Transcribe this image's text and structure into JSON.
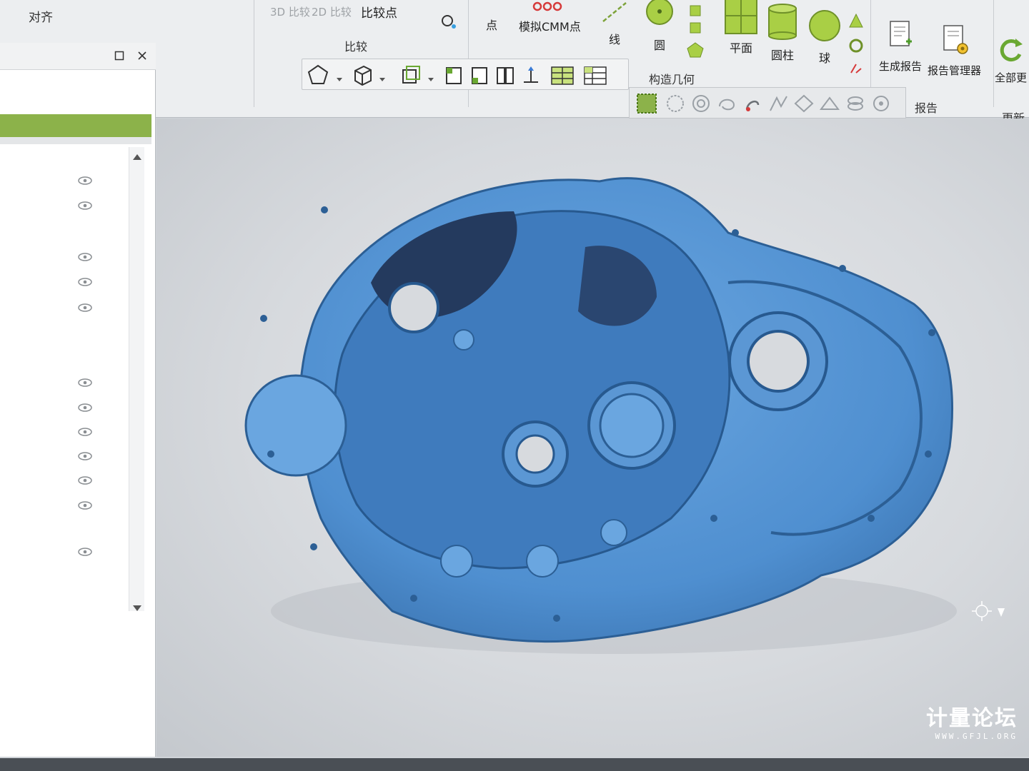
{
  "ribbon": {
    "align_group": {
      "label": "对齐"
    },
    "compare_group": {
      "label": "比较",
      "buttons": [
        {
          "label": "3D 比较"
        },
        {
          "label": "2D 比较"
        },
        {
          "label": "比较点"
        }
      ]
    },
    "construct_group": {
      "label": "构造几何",
      "buttons": [
        {
          "label": "点"
        },
        {
          "label": "模拟CMM点"
        },
        {
          "label": "线"
        },
        {
          "label": "圆"
        },
        {
          "label": "平面"
        },
        {
          "label": "圆柱"
        },
        {
          "label": "球"
        }
      ]
    },
    "report_group": {
      "label": "报告",
      "buttons": [
        {
          "label": "生成报告"
        },
        {
          "label": "报告管理器"
        }
      ]
    },
    "update_group": {
      "label": "更新",
      "buttons": [
        {
          "label": "全部更"
        }
      ]
    }
  },
  "watermark": {
    "main": "计量论坛",
    "sub": "WWW.GFJL.ORG"
  },
  "colors": {
    "model": "#4f8fd0",
    "accent": "#8cb24a",
    "ribbon_bg": "#eceef0",
    "viewport_bg": "#d7dade"
  },
  "icons": [
    "restore-icon",
    "close-icon",
    "eye-icon",
    "scroll-up-icon",
    "scroll-down-icon",
    "cursor-icon"
  ]
}
